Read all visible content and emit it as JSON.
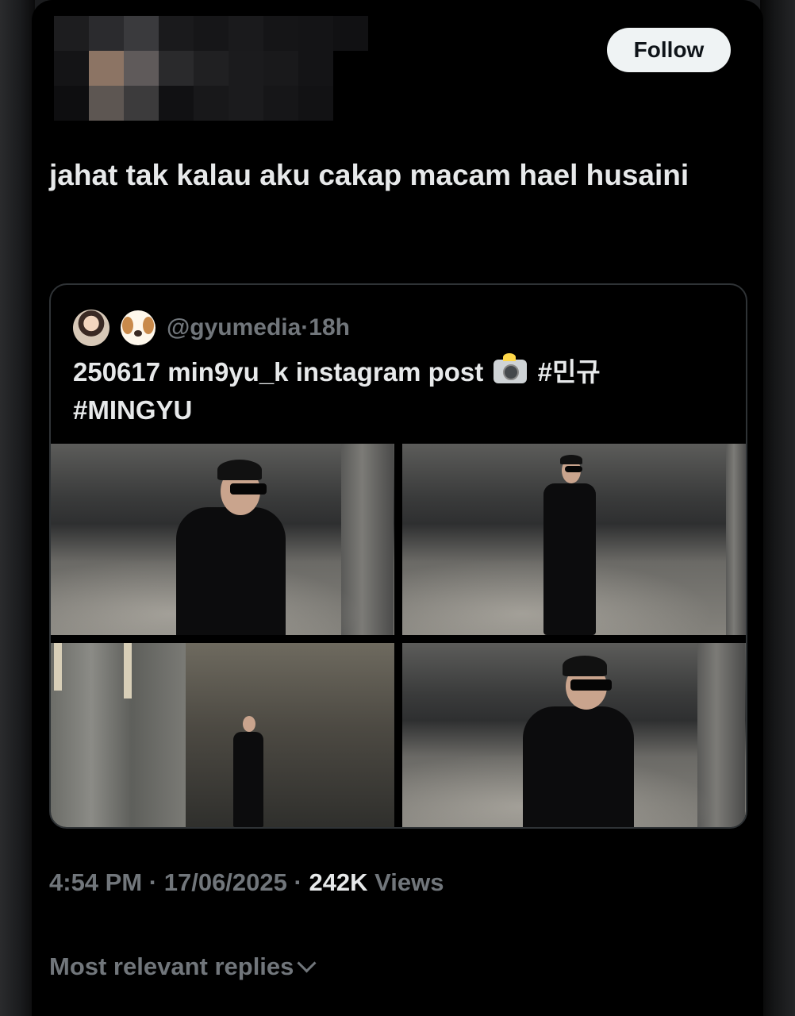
{
  "author": {
    "avatar_blurred": true
  },
  "follow_label": "Follow",
  "tweet": {
    "text": "jahat tak kalau aku cakap macam hael husaini"
  },
  "quote": {
    "handle": "@gyumedia",
    "time": "·18h",
    "text_before_icon": "250617 min9yu_k instagram post",
    "text_after_icon": "#민규 #MINGYU",
    "icons": [
      "avatar-photo",
      "dog-emoji-icon",
      "camera-flash-icon"
    ],
    "photos": [
      {
        "alt": "man in black leather suit and sunglasses, close crop"
      },
      {
        "alt": "man in black leather suit standing full length"
      },
      {
        "alt": "man standing far away near tall window"
      },
      {
        "alt": "man in black leather suit, half body"
      }
    ]
  },
  "meta": {
    "time": "4:54 PM",
    "sep1": " · ",
    "date": "17/06/2025",
    "sep2": " · ",
    "views_count": "242K",
    "views_label": " Views"
  },
  "replies": {
    "label": "Most relevant replies"
  },
  "colors": {
    "background": "#000000",
    "text": "#e7e9ea",
    "muted": "#71767b",
    "border": "#2f3336",
    "button": "#eff3f4"
  }
}
